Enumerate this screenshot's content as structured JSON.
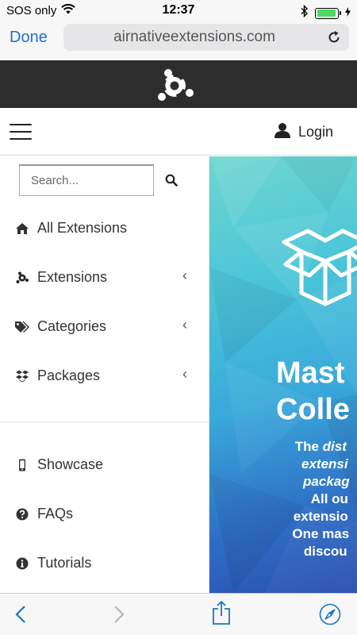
{
  "status_bar": {
    "carrier": "SOS only",
    "time": "12:37",
    "battery_level": 0.95
  },
  "browser": {
    "done_label": "Done",
    "url": "airnativeextensions.com"
  },
  "nav": {
    "login_label": "Login"
  },
  "sidebar": {
    "search_placeholder": "Search...",
    "items": [
      {
        "label": "All Extensions",
        "icon": "home-icon",
        "has_submenu": false
      },
      {
        "label": "Extensions",
        "icon": "extensions-logo-icon",
        "has_submenu": true
      },
      {
        "label": "Categories",
        "icon": "tags-icon",
        "has_submenu": true
      },
      {
        "label": "Packages",
        "icon": "dropbox-icon",
        "has_submenu": true
      },
      {
        "label": "Showcase",
        "icon": "mobile-icon",
        "has_submenu": false
      },
      {
        "label": "FAQs",
        "icon": "question-circle-icon",
        "has_submenu": false
      },
      {
        "label": "Tutorials",
        "icon": "info-circle-icon",
        "has_submenu": false
      }
    ]
  },
  "hero": {
    "title_line1": "Mast",
    "title_line2": "Colle",
    "desc_line1_a": "The ",
    "desc_line1_b": "dist",
    "desc_line2": "extensi",
    "desc_line3": "packag",
    "desc_line4": "All ou",
    "desc_line5": "extensio",
    "desc_line6": "One mas",
    "desc_line7": "discou"
  },
  "colors": {
    "accent": "#1a73c9",
    "header_bg": "#2d2d2d",
    "hero_top": "#6fd6cf",
    "hero_bottom": "#2a4fb0"
  }
}
